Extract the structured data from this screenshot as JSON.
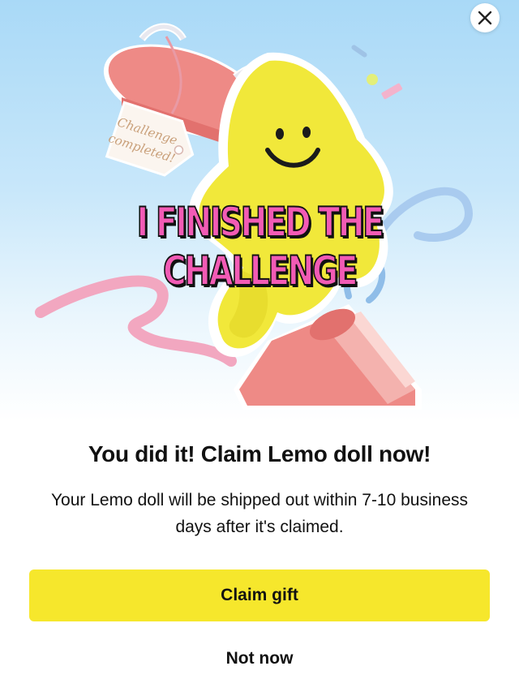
{
  "hero": {
    "banner_text": "I FINISHED THE CHALLENGE",
    "tag_line_1": "Challenge",
    "tag_line_2": "completed!"
  },
  "dialog": {
    "title": "You did it! Claim Lemo doll now!",
    "description": "Your Lemo doll will be shipped out within 7-10 business days after it's claimed.",
    "primary_button": "Claim gift",
    "secondary_button": "Not now"
  },
  "icons": {
    "close": "close-icon"
  },
  "colors": {
    "primary_button_bg": "#f6e72c",
    "banner_text": "#f25bb5",
    "hero_sky": "#a9d9f7",
    "gift_box": "#ee8a86",
    "lemo_doll": "#f1e83a"
  }
}
